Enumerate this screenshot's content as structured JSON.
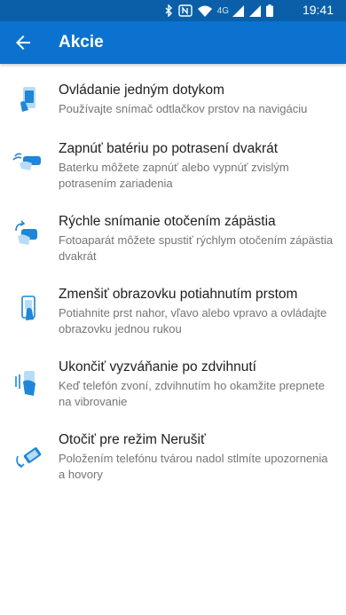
{
  "status_bar": {
    "network": "4G",
    "time": "19:41"
  },
  "app_bar": {
    "title": "Akcie"
  },
  "items": [
    {
      "title": "Ovládanie jedným dotykom",
      "desc": "Používajte snímač odtlačkov prstov na navigáciu",
      "icon": "one-touch-icon"
    },
    {
      "title": "Zapnúť batériu po potrasení dvakrát",
      "desc": "Baterku môžete zapnúť alebo vypnúť zvislým potrasením zariadenia",
      "icon": "shake-icon"
    },
    {
      "title": "Rýchle snímanie otočením zápästia",
      "desc": "Fotoaparát môžete spustiť rýchlym otočením zápästia dvakrát",
      "icon": "wrist-twist-icon"
    },
    {
      "title": "Zmenšiť obrazovku potiahnutím prstom",
      "desc": "Potiahnite prst nahor, vľavo alebo vpravo a ovládajte obrazovku jednou rukou",
      "icon": "swipe-icon"
    },
    {
      "title": "Ukončiť vyzváňanie po zdvihnutí",
      "desc": "Keď telefón zvoní, zdvihnutím ho okamžite prepnete na vibrovanie",
      "icon": "pickup-icon"
    },
    {
      "title": "Otočiť pre režim Nerušiť",
      "desc": "Položením telefónu tvárou nadol stlmíte upozornenia a hovory",
      "icon": "flip-icon"
    }
  ],
  "colors": {
    "status_bar": "#0a5fa8",
    "app_bar": "#0b73cf",
    "icon_blue": "#1f86d8",
    "icon_light": "#b9dcf6"
  }
}
